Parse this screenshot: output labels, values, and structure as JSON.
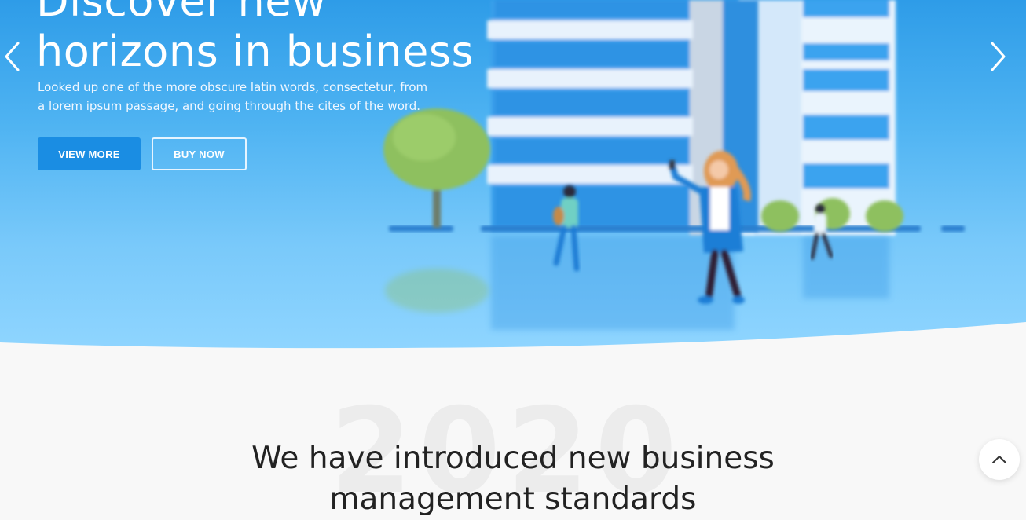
{
  "hero": {
    "title": "Discover new horizons in business",
    "subtitle": "Looked up one of the more obscure latin words, consectetur, from a lorem ipsum passage, and going through the cites of the word.",
    "buttons": {
      "view_more": "VIEW MORE",
      "buy_now": "BUY NOW"
    },
    "prev_icon": "chevron-left-icon",
    "next_icon": "chevron-right-icon"
  },
  "intro": {
    "background_year": "2020",
    "title": "We have introduced new business management standards"
  },
  "back_to_top_icon": "chevron-up-icon",
  "colors": {
    "primary": "#1a8de3",
    "hero_top": "#2e9ce8",
    "hero_bottom": "#8fd5ff",
    "page_background": "#f8f8f8",
    "heading": "#222222"
  }
}
